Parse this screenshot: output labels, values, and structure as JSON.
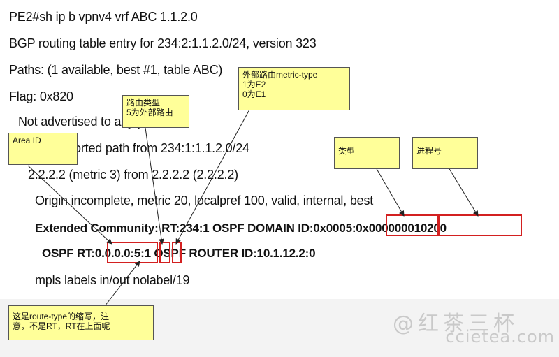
{
  "lines": [
    "PE2#sh ip b vpnv4 vrf ABC  1.1.2.0",
    "BGP routing table entry for 234:2:1.1.2.0/24, version 323",
    "Paths: (1 available, best #1, table ABC)",
    "Flag: 0x820",
    "Not advertised to any peer",
    "Local, imported path from 234:1:1.1.2.0/24",
    "2.2.2.2 (metric 3) from 2.2.2.2 (2.2.2.2)",
    "Origin incomplete, metric 20, localpref 100, valid, internal, best",
    "Extended Community: RT:234:1 OSPF DOMAIN ID:0x0005:0x000000010200",
    "OSPF RT:0.0.0.0:5:1 OSPF ROUTER ID:10.1.12.2:0",
    "mpls labels in/out nolabel/19"
  ],
  "callouts": {
    "metric_type": "外部路由metric-type\n1为E2\n0为E1",
    "route_type": "路由类型\n5为外部路由",
    "area_id": "Area ID",
    "type": "类型",
    "process_id": "进程号",
    "rt_note": "这是route-type的缩写，注\n意，不是RT，RT在上面呢"
  },
  "watermark": {
    "line1": "@红茶三杯",
    "line2": "ccietea.com"
  },
  "colors": {
    "callout_bg": "#ffff99",
    "highlight": "#d32020",
    "watermark": "#c9c9c9"
  }
}
